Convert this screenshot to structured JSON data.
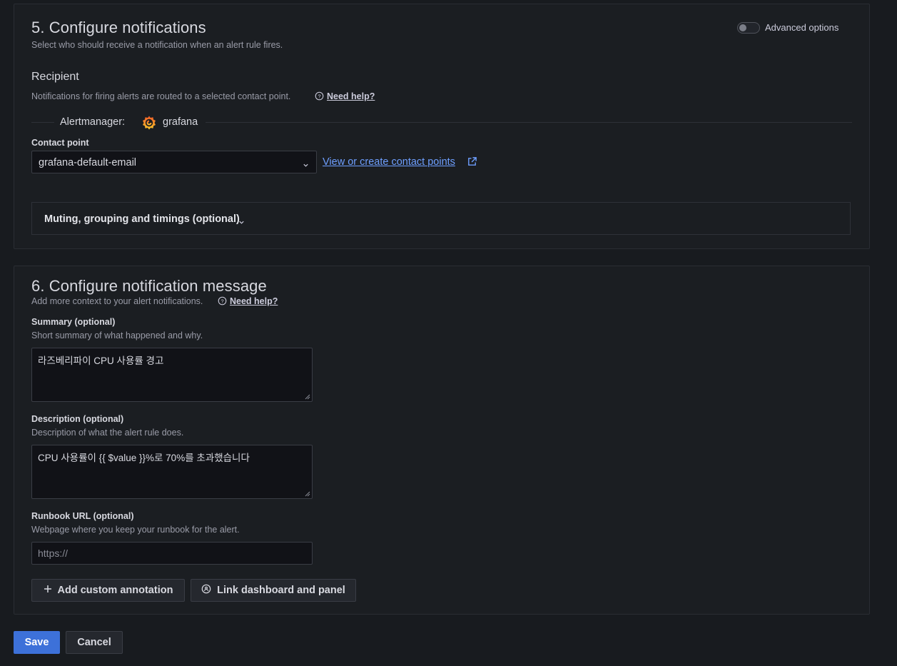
{
  "section5": {
    "title": "5. Configure notifications",
    "subtitle": "Select who should receive a notification when an alert rule fires.",
    "advanced_label": "Advanced options",
    "recipient_title": "Recipient",
    "recipient_desc": "Notifications for firing alerts are routed to a selected contact point.",
    "help_label": "Need help?",
    "alertmanager_label": "Alertmanager:",
    "alertmanager_name": "grafana",
    "contact_label": "Contact point",
    "contact_value": "grafana-default-email",
    "contact_link": "View or create contact points",
    "muting_label": "Muting, grouping and timings (optional)"
  },
  "section6": {
    "title": "6. Configure notification message",
    "subtitle": "Add more context to your alert notifications.",
    "help_label": "Need help?",
    "summary_label": "Summary (optional)",
    "summary_desc": "Short summary of what happened and why.",
    "summary_value": "라즈베리파이 CPU 사용률 경고",
    "description_label": "Description (optional)",
    "description_desc": "Description of what the alert rule does.",
    "description_value": "CPU 사용률이 {{ $value }}%로 70%를 초과했습니다",
    "runbook_label": "Runbook URL (optional)",
    "runbook_desc": "Webpage where you keep your runbook for the alert.",
    "runbook_placeholder": "https://",
    "add_annotation_label": "Add custom annotation",
    "link_dashboard_label": "Link dashboard and panel"
  },
  "footer": {
    "save_label": "Save",
    "cancel_label": "Cancel"
  },
  "colors": {
    "primary": "#3d71d9",
    "link": "#6e9fff",
    "background": "#181b1f"
  },
  "icons": [
    "help-circle-icon",
    "grafana-logo",
    "chevron-down-icon",
    "external-link-icon",
    "plus-icon",
    "apps-icon"
  ]
}
